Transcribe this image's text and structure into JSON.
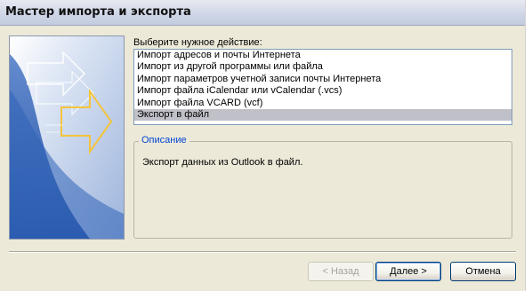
{
  "window": {
    "title": "Мастер импорта и экспорта"
  },
  "prompt": {
    "label": "Выберите нужное действие:"
  },
  "actions": [
    {
      "label": "Импорт адресов и почты Интернета",
      "selected": false
    },
    {
      "label": "Импорт из другой программы или файла",
      "selected": false
    },
    {
      "label": "Импорт параметров учетной записи почты Интернета",
      "selected": false
    },
    {
      "label": "Импорт файла iCalendar или vCalendar (.vcs)",
      "selected": false
    },
    {
      "label": "Импорт файла VCARD (vcf)",
      "selected": false
    },
    {
      "label": "Экспорт в файл",
      "selected": true
    }
  ],
  "description": {
    "legend": "Описание",
    "text": "Экспорт данных из Outlook в файл."
  },
  "buttons": {
    "back": "< Назад",
    "next": "Далее >",
    "cancel": "Отмена"
  },
  "colors": {
    "dialog_bg": "#ece9d8",
    "selection": "#c0c0c8",
    "legend_text": "#0046d5",
    "graphic_blue": "#2f63b8"
  }
}
